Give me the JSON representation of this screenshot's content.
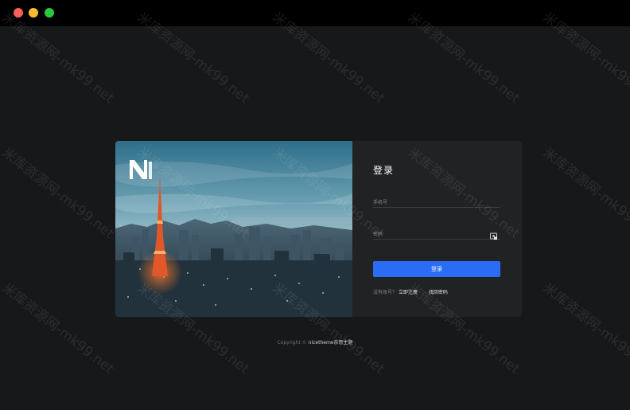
{
  "window": {
    "controls": [
      "close",
      "minimize",
      "maximize"
    ]
  },
  "hero": {
    "image": "tokyo-tower-city-skyline",
    "logo": "nicetheme-logo"
  },
  "login": {
    "title": "登录",
    "phone_placeholder": "手机号",
    "password_placeholder": "密码",
    "password_icon": "eye-icon",
    "submit_label": "登录",
    "no_account_text": "没有账号？",
    "register_link": "立即注册",
    "separator": "|",
    "forgot_link": "找回密码"
  },
  "footer": {
    "copyright": "Copyright ©",
    "brand": "nicetheme",
    "suffix": "奈思主题"
  },
  "watermark": {
    "text": "米库资源网-mk99.net"
  },
  "colors": {
    "background": "#17181a",
    "card": "#212224",
    "primary": "#2b6cf6",
    "titlebar": "#000000"
  }
}
